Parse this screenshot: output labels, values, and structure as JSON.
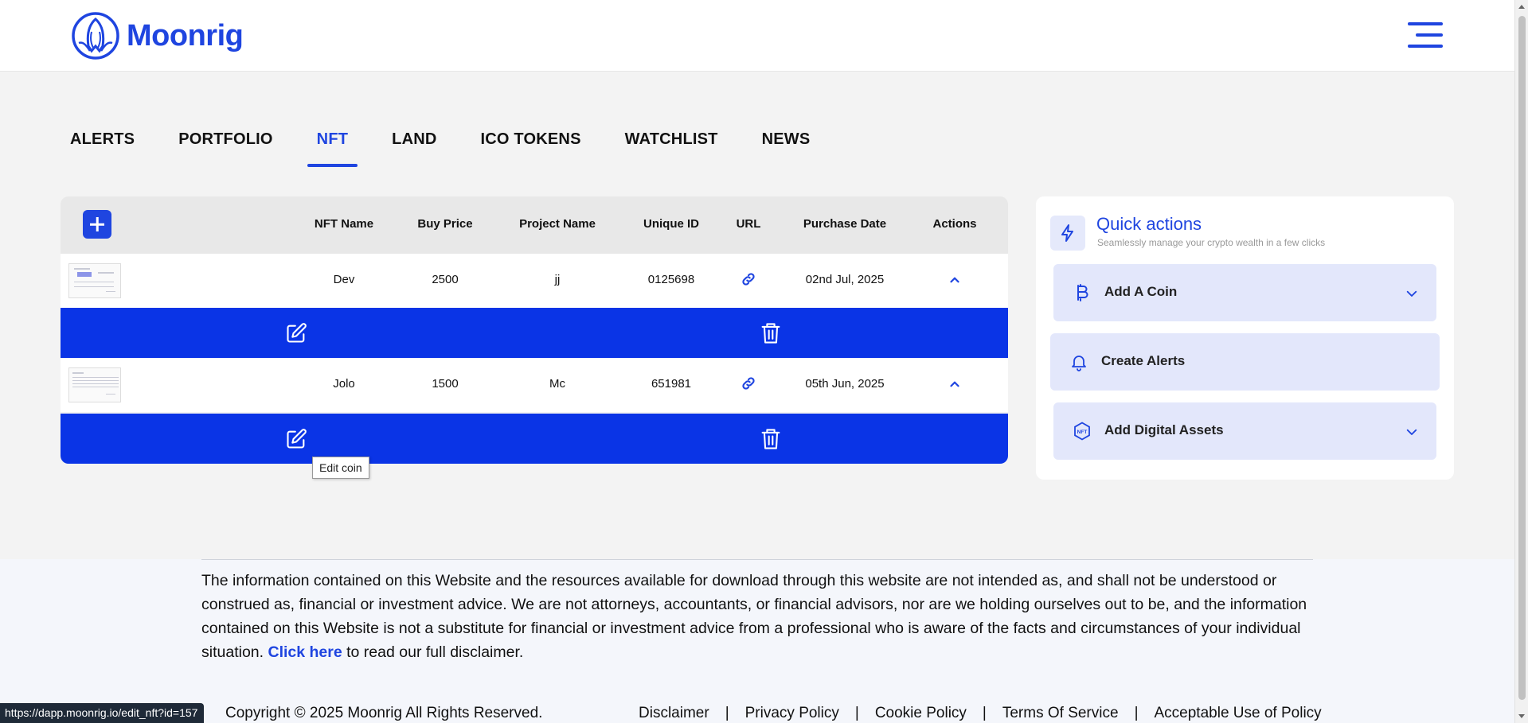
{
  "header": {
    "brand": "Moonrig",
    "brand_color": "#1f45e0",
    "menu_icon": "hamburger-icon"
  },
  "tabs": [
    {
      "label": "ALERTS",
      "active": false
    },
    {
      "label": "PORTFOLIO",
      "active": false
    },
    {
      "label": "NFT",
      "active": true
    },
    {
      "label": "LAND",
      "active": false
    },
    {
      "label": "ICO TOKENS",
      "active": false
    },
    {
      "label": "WATCHLIST",
      "active": false
    },
    {
      "label": "NEWS",
      "active": false
    }
  ],
  "table": {
    "columns": [
      "NFT Name",
      "Buy Price",
      "Project Name",
      "Unique ID",
      "URL",
      "Purchase Date",
      "Actions"
    ],
    "rows": [
      {
        "nft_name": "Dev",
        "buy_price": "2500",
        "project_name": "jj",
        "unique_id": "0125698",
        "purchase_date": "02nd Jul, 2025"
      },
      {
        "nft_name": "Jolo",
        "buy_price": "1500",
        "project_name": "Mc",
        "unique_id": "651981",
        "purchase_date": "05th Jun, 2025"
      }
    ],
    "action_bar_color": "#0a34e6"
  },
  "tooltip": "Edit coin",
  "quick_actions": {
    "title": "Quick actions",
    "subtitle": "Seamlessly manage your crypto wealth in a few clicks",
    "items": [
      {
        "label": "Add A Coin",
        "icon": "bitcoin-icon",
        "expandable": true
      },
      {
        "label": "Create Alerts",
        "icon": "bell-icon",
        "expandable": false
      },
      {
        "label": "Add Digital Assets",
        "icon": "nft-icon",
        "expandable": true
      }
    ]
  },
  "footer": {
    "disclaimer_text": "The information contained on this Website and the resources available for download through this website are not intended as, and shall not be understood or construed as, financial or investment advice. We are not attorneys, accountants, or financial advisors, nor are we holding ourselves out to be, and the information contained on this Website is not a substitute for financial or investment advice from a professional who is aware of the facts and circumstances of your individual situation.",
    "disclaimer_link": "Click here",
    "disclaimer_tail": "to read our full disclaimer.",
    "copyright": "Copyright © 2025 Moonrig All Rights Reserved.",
    "links": [
      "Disclaimer",
      "Privacy Policy",
      "Cookie Policy",
      "Terms Of Service",
      "Acceptable Use of Policy"
    ],
    "separator": "|"
  },
  "status_url": "https://dapp.moonrig.io/edit_nft?id=157"
}
